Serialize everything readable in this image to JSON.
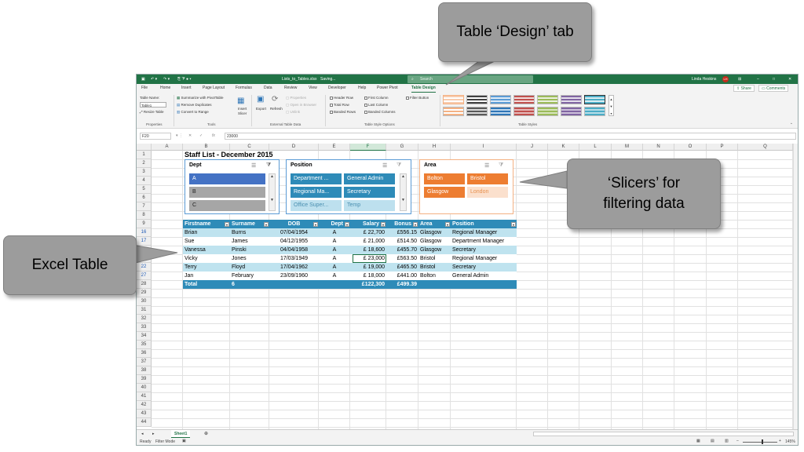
{
  "window": {
    "filename": "Lists_to_Tables.xlsx",
    "saving": "Saving...",
    "search_placeholder": "Search",
    "user_name": "Linda Heskins",
    "user_initials": "LH",
    "minimize": "–",
    "restore": "□",
    "close": "✕"
  },
  "ribbon_tabs": [
    "File",
    "Home",
    "Insert",
    "Page Layout",
    "Formulas",
    "Data",
    "Review",
    "View",
    "Developer",
    "Help",
    "Power Pivot",
    "Table Design"
  ],
  "share_label": "Share",
  "comments_label": "Comments",
  "ribbon": {
    "properties": {
      "table_name_label": "Table Name:",
      "table_name_value": "Table1",
      "resize_label": "Resize Table",
      "group": "Properties"
    },
    "tools": {
      "summarize": "Summarize with PivotTable",
      "remove_duplicates": "Remove Duplicates",
      "convert": "Convert to Range",
      "group": "Tools"
    },
    "insert_slicer": [
      "Insert",
      "Slicer"
    ],
    "external": {
      "export": "Export",
      "refresh": "Refresh",
      "properties": "Properties",
      "open_browser": "Open in Browser",
      "unlink": "Unlink",
      "group": "External Table Data"
    },
    "style_options": {
      "header_row": "Header Row",
      "total_row": "Total Row",
      "banded_rows": "Banded Rows",
      "first_column": "First Column",
      "last_column": "Last Column",
      "banded_columns": "Banded Columns",
      "filter_button": "Filter Button",
      "group": "Table Style Options"
    },
    "table_styles_group": "Table Styles"
  },
  "formula": {
    "name_box": "F20",
    "fx": "fx",
    "value": "23000"
  },
  "columns": [
    "A",
    "B",
    "C",
    "D",
    "E",
    "F",
    "G",
    "H",
    "I",
    "J",
    "K",
    "L",
    "M",
    "N",
    "O",
    "P",
    "Q"
  ],
  "rows": [
    "1",
    "2",
    "3",
    "4",
    "5",
    "6",
    "7",
    "8",
    "9",
    "16",
    "17",
    "20",
    "21",
    "22",
    "27",
    "28",
    "29",
    "30",
    "31",
    "32",
    "33",
    "34",
    "35",
    "36",
    "37",
    "38",
    "39",
    "40",
    "41",
    "42",
    "43",
    "44"
  ],
  "sheet_title": "Staff List - December 2015",
  "slicers": {
    "dept": {
      "title": "Dept",
      "items": [
        "A",
        "B",
        "C"
      ]
    },
    "position": {
      "title": "Position",
      "items": [
        "Department ...",
        "General Admin",
        "Regional Ma...",
        "Secretary",
        "Office Super...",
        "Temp"
      ]
    },
    "area": {
      "title": "Area",
      "items": [
        "Bolton",
        "Bristol",
        "Glasgow",
        "London"
      ]
    }
  },
  "table": {
    "headers": [
      "Firstname",
      "Surname",
      "DOB",
      "Dept",
      "Salary",
      "Bonus",
      "Area",
      "Position"
    ],
    "rows": [
      [
        "Brian",
        "Burns",
        "07/04/1954",
        "A",
        "£  22,700",
        "£556.15",
        "Glasgow",
        "Regional Manager"
      ],
      [
        "Sue",
        "James",
        "04/12/1955",
        "A",
        "£  21,000",
        "£514.50",
        "Glasgow",
        "Department Manager"
      ],
      [
        "Vanessa",
        "Pinski",
        "04/04/1958",
        "A",
        "£  18,600",
        "£455.70",
        "Glasgow",
        "Secretary"
      ],
      [
        "Vicky",
        "Jones",
        "17/03/1949",
        "A",
        "£  23,000",
        "£563.50",
        "Bristol",
        "Regional Manager"
      ],
      [
        "Terry",
        "Floyd",
        "17/04/1962",
        "A",
        "£  19,000",
        "£465.50",
        "Bristol",
        "Secretary"
      ],
      [
        "Jan",
        "February",
        "23/09/1960",
        "A",
        "£  18,000",
        "£441.00",
        "Bolton",
        "General Admin"
      ]
    ],
    "total": [
      "Total",
      "6",
      "",
      "",
      "£122,300",
      "£499.39",
      "",
      ""
    ]
  },
  "sheet_tab": "Sheet1",
  "status": {
    "ready": "Ready",
    "filter_mode": "Filter Mode",
    "zoom": "145%"
  },
  "callouts": {
    "design_tab": "Table ‘Design’ tab",
    "slicers": "‘Slicers’ for filtering data",
    "excel_table": "Excel Table"
  }
}
